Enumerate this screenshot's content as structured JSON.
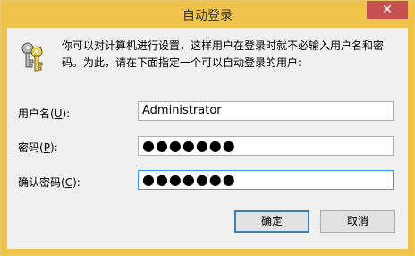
{
  "window": {
    "title": "自动登录",
    "close_glyph": "✕"
  },
  "description": {
    "line1": "你可以对计算机进行设置，这样用户在登录时就不必输入用户名和密",
    "line2": "码。为此，请在下面指定一个可以自动登录的用户:"
  },
  "fields": {
    "username": {
      "label_pre": "用户名(",
      "accel": "U",
      "label_post": "):",
      "value": "Administrator"
    },
    "password": {
      "label_pre": "密码(",
      "accel": "P",
      "label_post": "):",
      "value": "●●●●●●●"
    },
    "confirm": {
      "label_pre": "确认密码(",
      "accel": "C",
      "label_post": "):",
      "value": "●●●●●●●"
    }
  },
  "buttons": {
    "ok": "确定",
    "cancel": "取消"
  },
  "colors": {
    "titlebar": "#f0c34d",
    "close": "#c75050",
    "focus_border": "#3399ff",
    "default_button_border": "#3c7fb1"
  }
}
